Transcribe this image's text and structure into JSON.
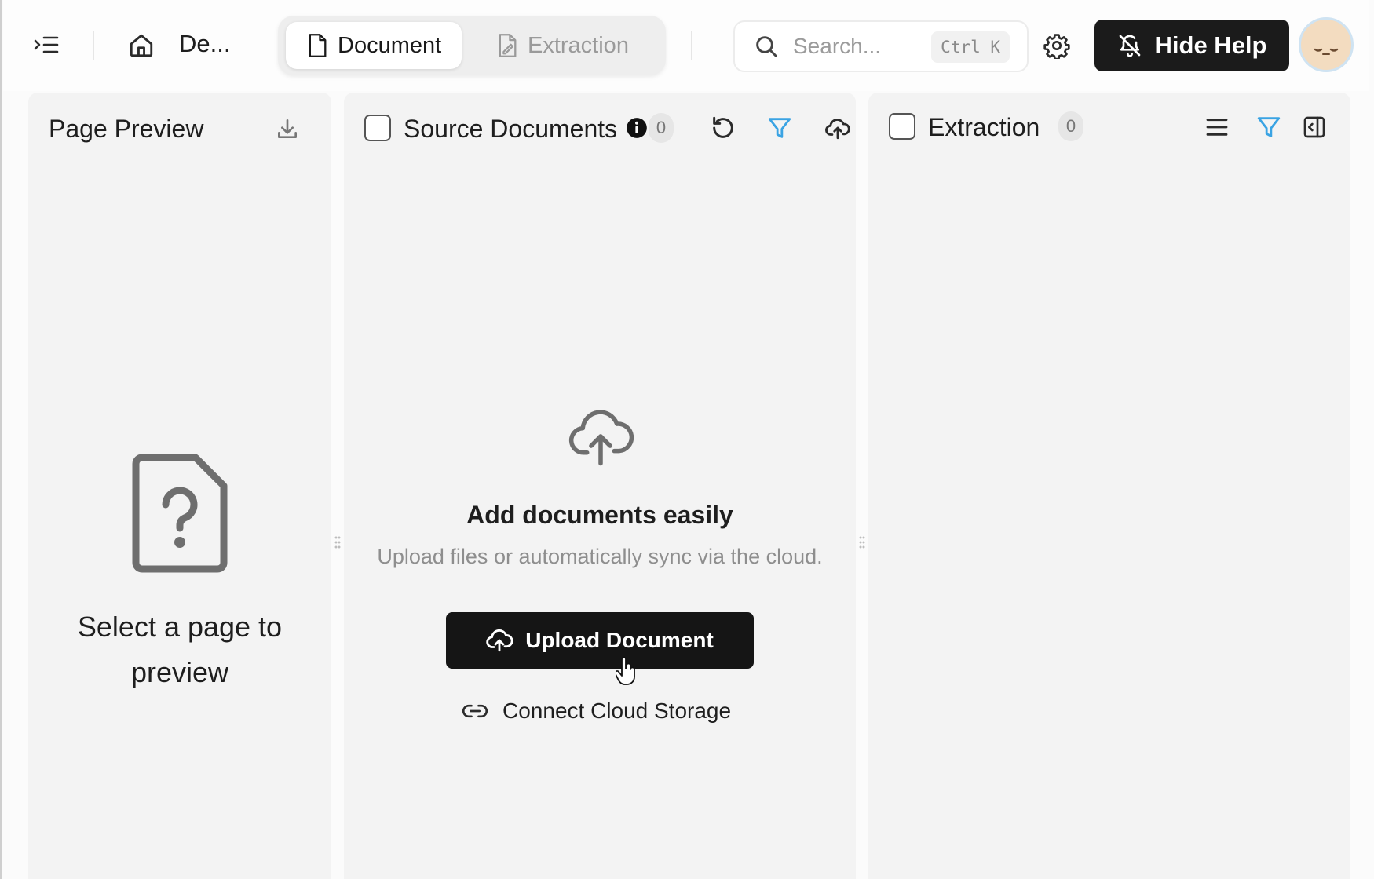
{
  "header": {
    "breadcrumb": "De...",
    "tabs": [
      {
        "label": "Document",
        "active": true
      },
      {
        "label": "Extraction",
        "active": false
      }
    ],
    "search": {
      "placeholder": "Search...",
      "shortcut": "Ctrl K"
    },
    "hide_help_label": "Hide Help"
  },
  "panels": {
    "preview": {
      "title": "Page Preview",
      "empty_message": "Select a page to preview"
    },
    "source": {
      "title": "Source Documents",
      "count": "0",
      "empty_title": "Add documents easily",
      "empty_subtitle": "Upload files or automatically sync via the cloud.",
      "upload_label": "Upload Document",
      "cloud_label": "Connect Cloud Storage"
    },
    "extraction": {
      "title": "Extraction",
      "count": "0"
    }
  },
  "colors": {
    "accent_filter": "#3aa3e3",
    "primary_button": "#151515",
    "panel_bg": "#f3f3f3"
  },
  "icons": [
    "sidebar-toggle-icon",
    "home-icon",
    "document-icon",
    "extraction-icon",
    "search-icon",
    "gear-icon",
    "bell-off-icon",
    "download-icon",
    "info-icon",
    "refresh-icon",
    "filter-icon",
    "cloud-upload-icon",
    "menu-icon",
    "panel-collapse-icon",
    "file-question-icon",
    "link-icon"
  ]
}
